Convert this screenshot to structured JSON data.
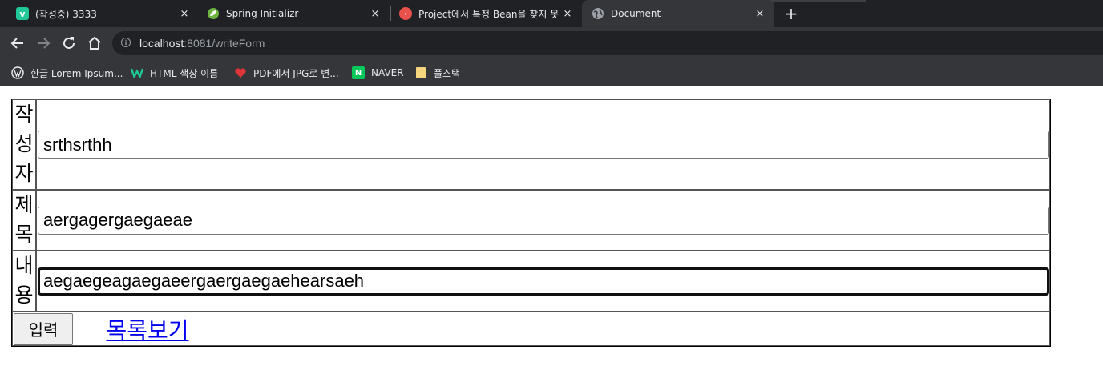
{
  "browser": {
    "tabs": [
      {
        "title": "(작성중) 3333",
        "favicon": "velog-icon",
        "active": false
      },
      {
        "title": "Spring Initializr",
        "favicon": "spring-icon",
        "active": false
      },
      {
        "title": "Project에서 특정 Bean을 찾지 못",
        "favicon": "pinned-icon",
        "active": false
      },
      {
        "title": "Document",
        "favicon": "globe-icon",
        "active": true
      }
    ],
    "close_glyph": "×",
    "new_tab_glyph": "+",
    "address": {
      "host": "localhost",
      "rest": ":8081/writeForm"
    },
    "bookmarks": [
      {
        "label": "한글 Lorem Ipsum...",
        "icon": "wordpress-icon"
      },
      {
        "label": "HTML 색상 이름",
        "icon": "w-logo-icon"
      },
      {
        "label": "PDF에서 JPG로 변...",
        "icon": "heart-icon"
      },
      {
        "label": "NAVER",
        "icon": "naver-icon"
      },
      {
        "label": "풀스택",
        "icon": "folder-icon"
      }
    ]
  },
  "form": {
    "writer_label": "작성자",
    "writer_value": "srthsrthh",
    "title_label": "제목",
    "title_value": "aergagergaegaeae",
    "content_label": "내용",
    "content_value": "aegaegeagaegaeergaergaegaehearsaeh",
    "submit_label": "입력",
    "list_link_label": "목록보기"
  },
  "colors": {
    "link": "#0000ee",
    "chrome_dark": "#202124",
    "chrome_mid": "#35363a"
  }
}
